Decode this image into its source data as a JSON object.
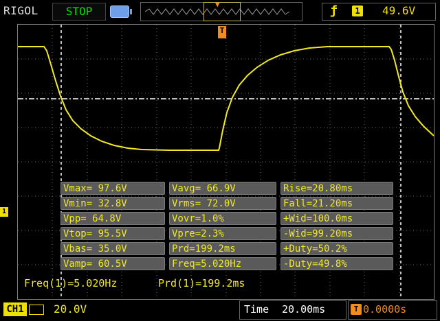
{
  "header": {
    "brand": "RIGOL",
    "run_state": "STOP",
    "trigger_source": "1",
    "trigger_level": "49.6V"
  },
  "measurements": [
    [
      "Vmax= 97.6V",
      "Vavg= 66.9V",
      "Rise=20.80ms"
    ],
    [
      "Vmin= 32.8V",
      "Vrms= 72.0V",
      "Fall=21.20ms"
    ],
    [
      "Vpp= 64.8V",
      "Vovr=1.0%",
      "+Wid=100.0ms"
    ],
    [
      "Vtop= 95.5V",
      "Vpre=2.3%",
      "-Wid=99.20ms"
    ],
    [
      "Vbas= 35.0V",
      "Prd=199.2ms",
      "+Duty=50.2%"
    ],
    [
      "Vamp= 60.5V",
      "Freq=5.020Hz",
      "-Duty=49.8%"
    ]
  ],
  "counter": {
    "freq": "Freq(1)=5.020Hz",
    "period": "Prd(1)=199.2ms"
  },
  "footer": {
    "channel": "CH1",
    "volts_per_div": "20.0V",
    "time_label": "Time",
    "time_per_div": "20.00ms",
    "trigger_offset": "0.0000s"
  },
  "markers": {
    "channel": "1",
    "trigger": "T"
  },
  "colors": {
    "trace": "#f2ea22",
    "trigger": "#f28c1c",
    "run_state": "#00e000"
  }
}
